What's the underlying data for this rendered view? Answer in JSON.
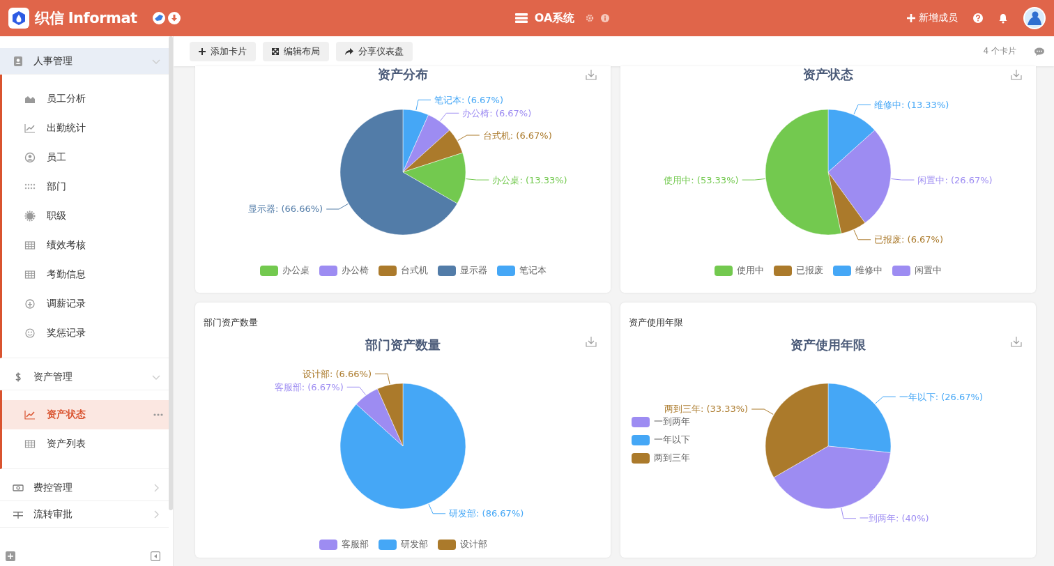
{
  "topbar": {
    "brand": "织信 Informat",
    "app_title": "OA系统",
    "add_member": "新增成员"
  },
  "sidebar": {
    "groups": [
      {
        "label": "人事管理",
        "expanded": true,
        "highlighted": true,
        "items": [
          {
            "label": "员工分析",
            "selected": false
          },
          {
            "label": "出勤统计",
            "selected": false
          },
          {
            "label": "员工",
            "selected": false
          },
          {
            "label": "部门",
            "selected": false
          },
          {
            "label": "职级",
            "selected": false
          },
          {
            "label": "绩效考核",
            "selected": false
          },
          {
            "label": "考勤信息",
            "selected": false
          },
          {
            "label": "调薪记录",
            "selected": false
          },
          {
            "label": "奖惩记录",
            "selected": false
          }
        ]
      },
      {
        "label": "资产管理",
        "expanded": true,
        "highlighted": false,
        "items": [
          {
            "label": "资产状态",
            "selected": true
          },
          {
            "label": "资产列表",
            "selected": false
          }
        ]
      },
      {
        "label": "费控管理",
        "expanded": false,
        "highlighted": false
      },
      {
        "label": "流转审批",
        "expanded": false,
        "highlighted": false
      }
    ]
  },
  "toolbar": {
    "buttons": [
      "添加卡片",
      "编辑布局",
      "分享仪表盘"
    ],
    "card_count": "4 个卡片"
  },
  "cards": [
    {
      "chart_data": {
        "type": "pie",
        "title": "资产分布",
        "categories": [
          "笔记本",
          "办公椅",
          "台式机",
          "办公桌",
          "显示器"
        ],
        "values": [
          6.67,
          6.67,
          6.67,
          13.33,
          66.66
        ],
        "colors": [
          "#45a7f6",
          "#9d8cf2",
          "#ab7a2b",
          "#73c94f",
          "#527ca8"
        ],
        "value_labels": [
          "笔记本: (6.67%)",
          "办公椅: (6.67%)",
          "台式机: (6.67%)",
          "办公桌: (13.33%)",
          "显示器: (66.66%)"
        ],
        "legend": "bottom"
      }
    },
    {
      "chart_data": {
        "type": "pie",
        "title": "资产状态",
        "categories": [
          "维修中",
          "闲置中",
          "已报废",
          "使用中"
        ],
        "values": [
          13.33,
          26.67,
          6.67,
          53.33
        ],
        "colors": [
          "#45a7f6",
          "#9d8cf2",
          "#ab7a2b",
          "#73c94f"
        ],
        "value_labels": [
          "维修中: (13.33%)",
          "闲置中: (26.67%)",
          "已报废: (6.67%)",
          "使用中: (53.33%)"
        ],
        "legend": "bottom"
      }
    },
    {
      "header": "部门资产数量",
      "chart_data": {
        "type": "pie",
        "title": "部门资产数量",
        "categories": [
          "研发部",
          "客服部",
          "设计部"
        ],
        "values": [
          86.67,
          6.67,
          6.66
        ],
        "colors": [
          "#45a7f6",
          "#9d8cf2",
          "#ab7a2b"
        ],
        "value_labels": [
          "研发部: (86.67%)",
          "客服部: (6.67%)",
          "设计部: (6.66%)"
        ],
        "legend": "bottom"
      }
    },
    {
      "header": "资产使用年限",
      "chart_data": {
        "type": "pie",
        "title": "资产使用年限",
        "categories": [
          "一年以下",
          "一到两年",
          "两到三年"
        ],
        "values": [
          26.67,
          40,
          33.33
        ],
        "colors": [
          "#45a7f6",
          "#9d8cf2",
          "#ab7a2b"
        ],
        "value_labels": [
          "一年以下: (26.67%)",
          "一到两年: (40%)",
          "两到三年: (33.33%)"
        ],
        "legend": "left"
      }
    }
  ]
}
